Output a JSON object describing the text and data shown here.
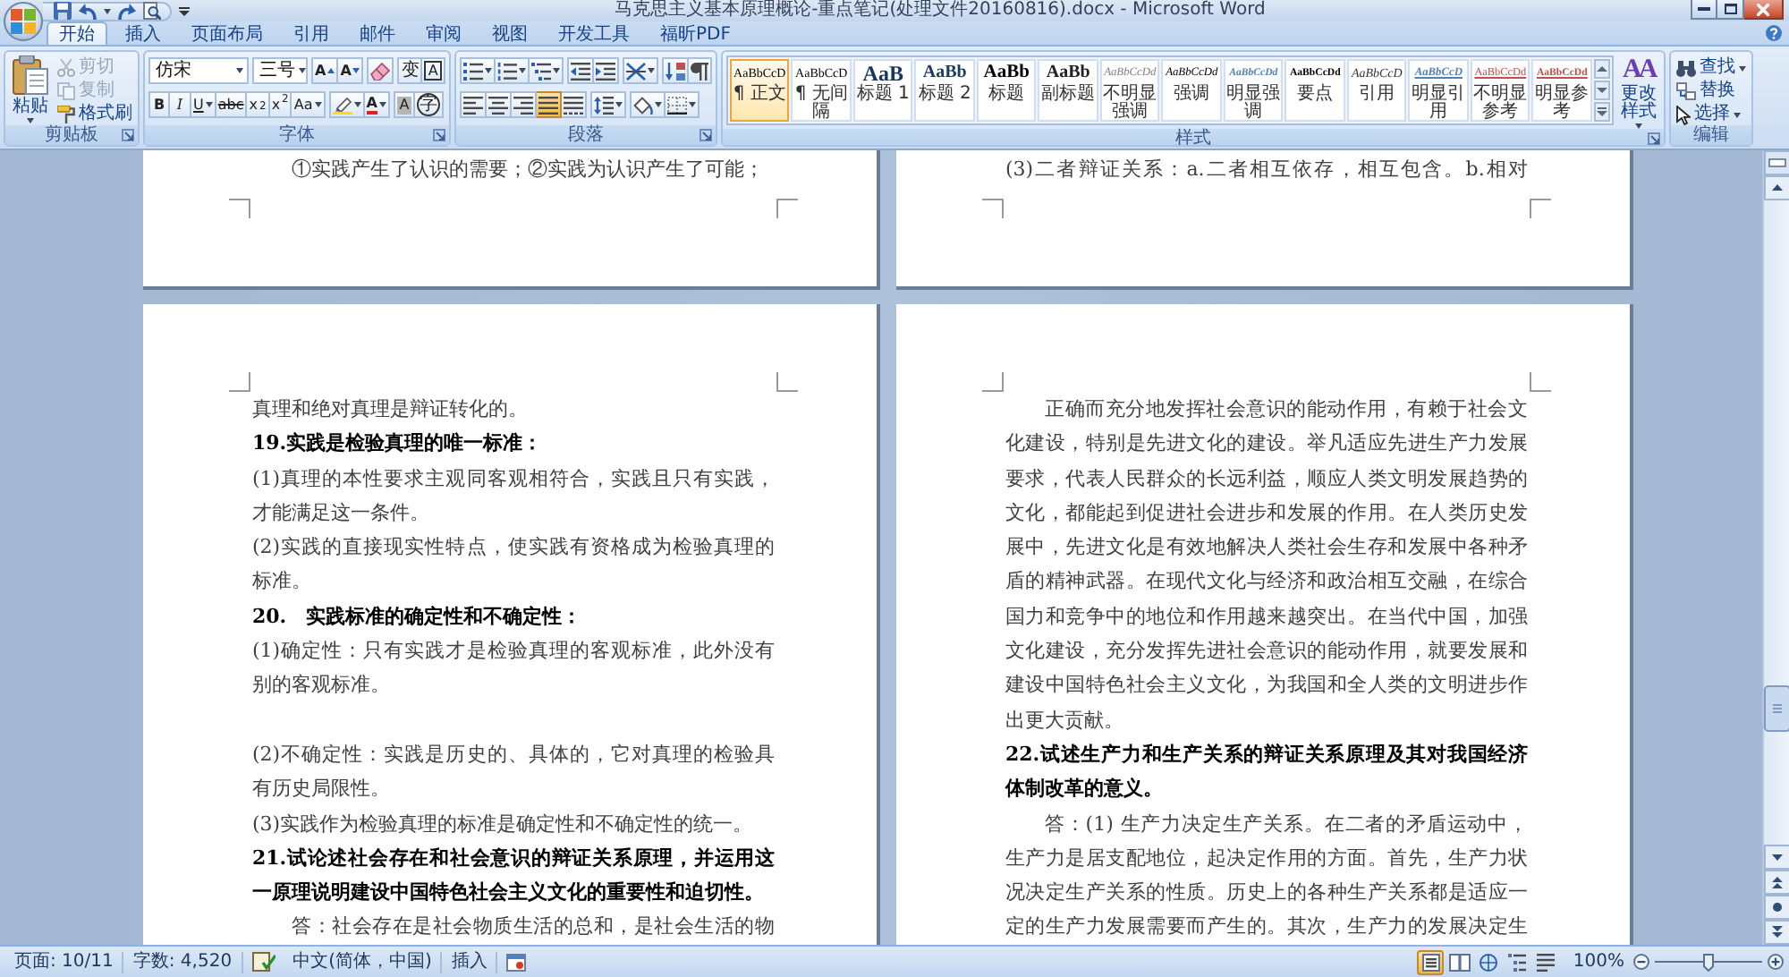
{
  "window": {
    "title": "马克思主义基本原理概论-重点笔记(处理文件20160816).docx - Microsoft Word"
  },
  "ribbon": {
    "tabs": [
      {
        "label": "开始",
        "selected": true
      },
      {
        "label": "插入",
        "selected": false
      },
      {
        "label": "页面布局",
        "selected": false
      },
      {
        "label": "引用",
        "selected": false
      },
      {
        "label": "邮件",
        "selected": false
      },
      {
        "label": "审阅",
        "selected": false
      },
      {
        "label": "视图",
        "selected": false
      },
      {
        "label": "开发工具",
        "selected": false
      },
      {
        "label": "福昕PDF",
        "selected": false
      }
    ],
    "clipboard": {
      "title": "剪贴板",
      "paste": "粘贴",
      "commands": [
        {
          "kind": "cut",
          "label": "剪切",
          "disabled": true
        },
        {
          "kind": "copy",
          "label": "复制",
          "disabled": true
        },
        {
          "kind": "format-painter",
          "label": "格式刷",
          "disabled": false
        }
      ]
    },
    "font": {
      "title": "字体",
      "font_name": "仿宋",
      "font_size": "三号",
      "grow_font": "A",
      "shrink_font": "A",
      "phonetic_guide": "变",
      "character_border": "A",
      "bold": "B",
      "italic": "I",
      "underline": "U",
      "strikethrough": "abc",
      "subscript": "x$_{2}$",
      "superscript": "x$^{2}$",
      "change_case": "Aa",
      "font_color": "A",
      "character_shading": "A",
      "enclosed_character": "字"
    },
    "paragraph": {
      "title": "段落",
      "alignment": [
        {
          "kind": "left",
          "selected": false
        },
        {
          "kind": "center",
          "selected": false
        },
        {
          "kind": "right",
          "selected": false
        },
        {
          "kind": "justify",
          "selected": true
        },
        {
          "kind": "distributed",
          "selected": false
        }
      ]
    },
    "styles": {
      "title": "样式",
      "gallery": [
        {
          "kind": "normal",
          "preview": "AaBbCcD",
          "label": "¶ 正文",
          "selected": true
        },
        {
          "kind": "no-spacing",
          "preview": "AaBbCcD",
          "label": "¶ 无间隔",
          "selected": false
        },
        {
          "kind": "heading-1",
          "preview": "AaB",
          "label": "标题 1",
          "selected": false
        },
        {
          "kind": "heading-2",
          "preview": "AaBb",
          "label": "标题 2",
          "selected": false
        },
        {
          "kind": "title",
          "preview": "AaBb",
          "label": "标题",
          "selected": false
        },
        {
          "kind": "subtitle",
          "preview": "AaBb",
          "label": "副标题",
          "selected": false
        },
        {
          "kind": "subtle-emphasis",
          "preview": "AaBbCcDd",
          "label": "不明显强调",
          "selected": false
        },
        {
          "kind": "emphasis",
          "preview": "AaBbCcDd",
          "label": "强调",
          "selected": false
        },
        {
          "kind": "intense-emphasis",
          "preview": "AaBbCcDd",
          "label": "明显强调",
          "selected": false
        },
        {
          "kind": "strong",
          "preview": "AaBbCcDd",
          "label": "要点",
          "selected": false
        },
        {
          "kind": "quote",
          "preview": "AaBbCcD",
          "label": "引用",
          "selected": false
        },
        {
          "kind": "intense-quote",
          "preview": "AaBbCcD",
          "label": "明显引用",
          "selected": false
        },
        {
          "kind": "subtle-reference",
          "preview": "AaBbCcDd",
          "label": "不明显参考",
          "selected": false
        },
        {
          "kind": "intense-reference",
          "preview": "AaBbCcDd",
          "label": "明显参考",
          "selected": false
        }
      ],
      "change_styles": {
        "icon_text": "AA",
        "label": "更改样式"
      }
    },
    "editing": {
      "title": "编辑",
      "commands": [
        {
          "kind": "find",
          "label": "查找"
        },
        {
          "kind": "replace",
          "label": "替换"
        },
        {
          "kind": "select",
          "label": "选择"
        }
      ]
    }
  },
  "document": {
    "top_pages": [
      {
        "paragraphs": [
          {
            "kind": "body",
            "indent": true,
            "lines": [
              "①实践产生了认识的需要；②实践为认识产生了可能；"
            ]
          }
        ]
      },
      {
        "paragraphs": [
          {
            "kind": "body",
            "continued": true,
            "lines": [
              "(3)二者辩证关系：a.二者相互依存，相互包含。b.相对"
            ]
          }
        ]
      }
    ],
    "pages": [
      {
        "paragraphs": [
          {
            "kind": "body",
            "lines": [
              "真理和绝对真理是辩证转化的。"
            ]
          },
          {
            "kind": "heading",
            "lines": [
              "19.实践是检验真理的唯一标准："
            ]
          },
          {
            "kind": "body",
            "lines": [
              "(1)真理的本性要求主观同客观相符合，实践且只有实践，",
              "才能满足这一条件。"
            ]
          },
          {
            "kind": "body",
            "lines": [
              "(2)实践的直接现实性特点，使实践有资格成为检验真理的",
              "标准。"
            ]
          },
          {
            "kind": "heading",
            "lines": [
              "20.　实践标准的确定性和不确定性："
            ]
          },
          {
            "kind": "body",
            "lines": [
              "(1)确定性：只有实践才是检验真理的客观标准，此外没有",
              "别的客观标准。"
            ]
          },
          {
            "kind": "blank"
          },
          {
            "kind": "body",
            "lines": [
              "(2)不确定性：实践是历史的、具体的，它对真理的检验具",
              "有历史局限性。"
            ]
          },
          {
            "kind": "body",
            "lines": [
              "(3)实践作为检验真理的标准是确定性和不确定性的统一。"
            ]
          },
          {
            "kind": "heading",
            "lines": [
              "21.试论述社会存在和社会意识的辩证关系原理，并运用这",
              "一原理说明建设中国特色社会主义文化的重要性和迫切性。"
            ]
          },
          {
            "kind": "body",
            "indent": true,
            "continued": true,
            "lines": [
              "答：社会存在是社会物质生活的总和，是社会生活的物"
            ]
          }
        ]
      },
      {
        "paragraphs": [
          {
            "kind": "body",
            "indent": true,
            "lines": [
              "正确而充分地发挥社会意识的能动作用，有赖于社会文",
              "化建设，特别是先进文化的建设。举凡适应先进生产力发展",
              "要求，代表人民群众的长远利益，顺应人类文明发展趋势的",
              "文化，都能起到促进社会进步和发展的作用。在人类历史发",
              "展中，先进文化是有效地解决人类社会生存和发展中各种矛",
              "盾的精神武器。在现代文化与经济和政治相互交融，在综合",
              "国力和竞争中的地位和作用越来越突出。在当代中国，加强",
              "文化建设，充分发挥先进社会意识的能动作用，就要发展和",
              "建设中国特色社会主义文化，为我国和全人类的文明进步作",
              "出更大贡献。"
            ]
          },
          {
            "kind": "heading",
            "lines": [
              "22.试述生产力和生产关系的辩证关系原理及其对我国经济",
              "体制改革的意义。"
            ]
          },
          {
            "kind": "body",
            "indent": true,
            "continued": true,
            "lines": [
              "答：(1) 生产力决定生产关系。在二者的矛盾运动中，",
              "生产力是居支配地位，起决定作用的方面。首先，生产力状",
              "况决定生产关系的性质。历史上的各种生产关系都是适应一",
              "定的生产力发展需要而产生的。其次，生产力的发展决定生"
            ]
          }
        ]
      }
    ]
  },
  "status_bar": {
    "page": "页面: 10/11",
    "words": "字数: 4,520",
    "language": "中文(简体，中国)",
    "mode": "插入",
    "views": [
      {
        "kind": "print-layout",
        "selected": true
      },
      {
        "kind": "full-screen-reading",
        "selected": false
      },
      {
        "kind": "web-layout",
        "selected": false
      },
      {
        "kind": "outline",
        "selected": false
      },
      {
        "kind": "draft",
        "selected": false
      }
    ],
    "zoom": "100%",
    "zoom_slider": {
      "level": 0.5
    }
  }
}
